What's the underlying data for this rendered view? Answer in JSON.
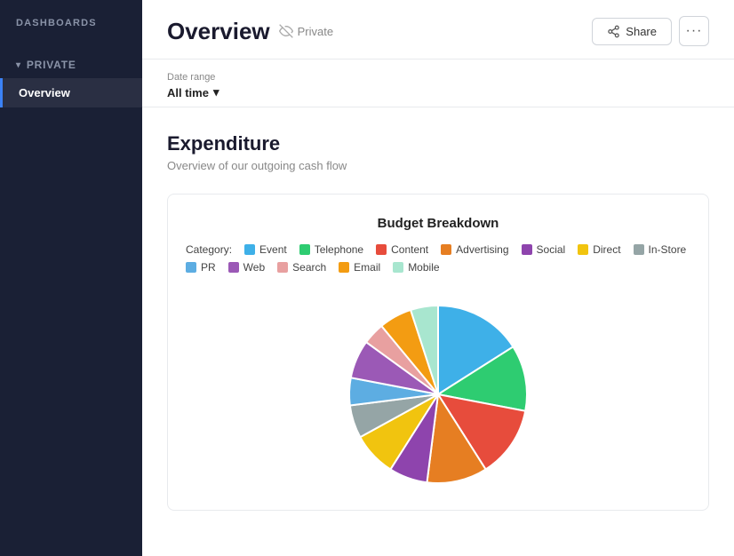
{
  "sidebar": {
    "title": "DASHBOARDS",
    "sections": [
      {
        "label": "PRIVATE",
        "collapsed": false,
        "items": [
          {
            "label": "Overview",
            "active": true
          }
        ]
      }
    ]
  },
  "header": {
    "title": "Overview",
    "visibility": "Private",
    "share_label": "Share",
    "more_label": "···"
  },
  "date_range": {
    "label": "Date range",
    "value": "All time"
  },
  "section": {
    "title": "Expenditure",
    "subtitle": "Overview of our outgoing cash flow"
  },
  "chart": {
    "title": "Budget Breakdown",
    "legend_prefix": "Category:",
    "categories": [
      {
        "label": "Event",
        "color": "#3eb0e8"
      },
      {
        "label": "Telephone",
        "color": "#2ecc71"
      },
      {
        "label": "Content",
        "color": "#e74c3c"
      },
      {
        "label": "Advertising",
        "color": "#e67e22"
      },
      {
        "label": "Social",
        "color": "#8e44ad"
      },
      {
        "label": "Direct",
        "color": "#f1c40f"
      },
      {
        "label": "In-Store",
        "color": "#95a5a6"
      },
      {
        "label": "PR",
        "color": "#5dade2"
      },
      {
        "label": "Web",
        "color": "#9b59b6"
      },
      {
        "label": "Search",
        "color": "#e8a0a0"
      },
      {
        "label": "Email",
        "color": "#f39c12"
      },
      {
        "label": "Mobile",
        "color": "#a8e6cf"
      }
    ],
    "segments": [
      {
        "label": "Event",
        "color": "#3eb0e8",
        "percent": 16
      },
      {
        "label": "Telephone",
        "color": "#2ecc71",
        "percent": 12
      },
      {
        "label": "Content",
        "color": "#e74c3c",
        "percent": 13
      },
      {
        "label": "Advertising",
        "color": "#e67e22",
        "percent": 11
      },
      {
        "label": "Social",
        "color": "#8e44ad",
        "percent": 7
      },
      {
        "label": "Direct",
        "color": "#f1c40f",
        "percent": 8
      },
      {
        "label": "In-Store",
        "color": "#95a5a6",
        "percent": 6
      },
      {
        "label": "PR",
        "color": "#5dade2",
        "percent": 5
      },
      {
        "label": "Web",
        "color": "#9b59b6",
        "percent": 7
      },
      {
        "label": "Search",
        "color": "#e8a0a0",
        "percent": 4
      },
      {
        "label": "Email",
        "color": "#f39c12",
        "percent": 6
      },
      {
        "label": "Mobile",
        "color": "#a8e6cf",
        "percent": 5
      }
    ]
  }
}
